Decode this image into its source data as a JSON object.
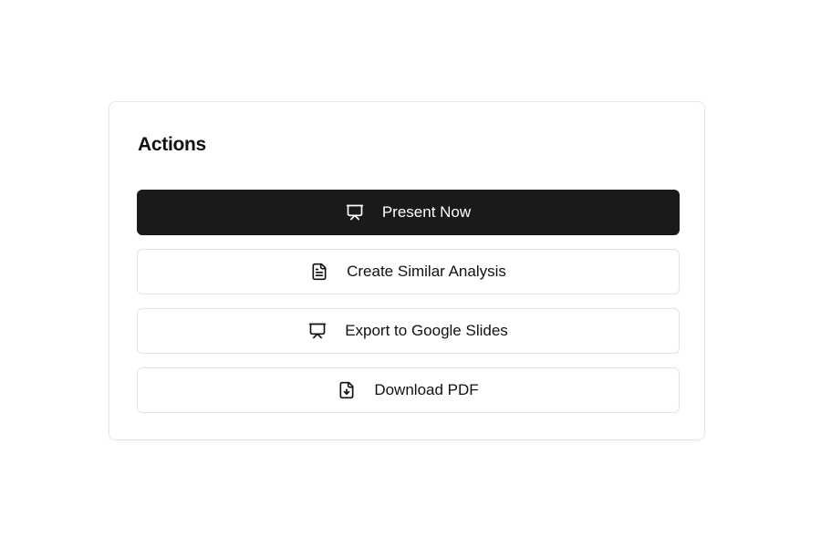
{
  "card": {
    "title": "Actions"
  },
  "actions": [
    {
      "label": "Present Now",
      "icon": "presentation-icon",
      "style": "primary"
    },
    {
      "label": "Create Similar Analysis",
      "icon": "document-icon",
      "style": "outline"
    },
    {
      "label": "Export to Google Slides",
      "icon": "presentation-icon",
      "style": "outline"
    },
    {
      "label": "Download PDF",
      "icon": "file-download-icon",
      "style": "outline"
    }
  ],
  "colors": {
    "primary_bg": "#1a1a1a",
    "primary_text": "#ffffff",
    "outline_border": "#e3e3e3",
    "text": "#111111"
  }
}
